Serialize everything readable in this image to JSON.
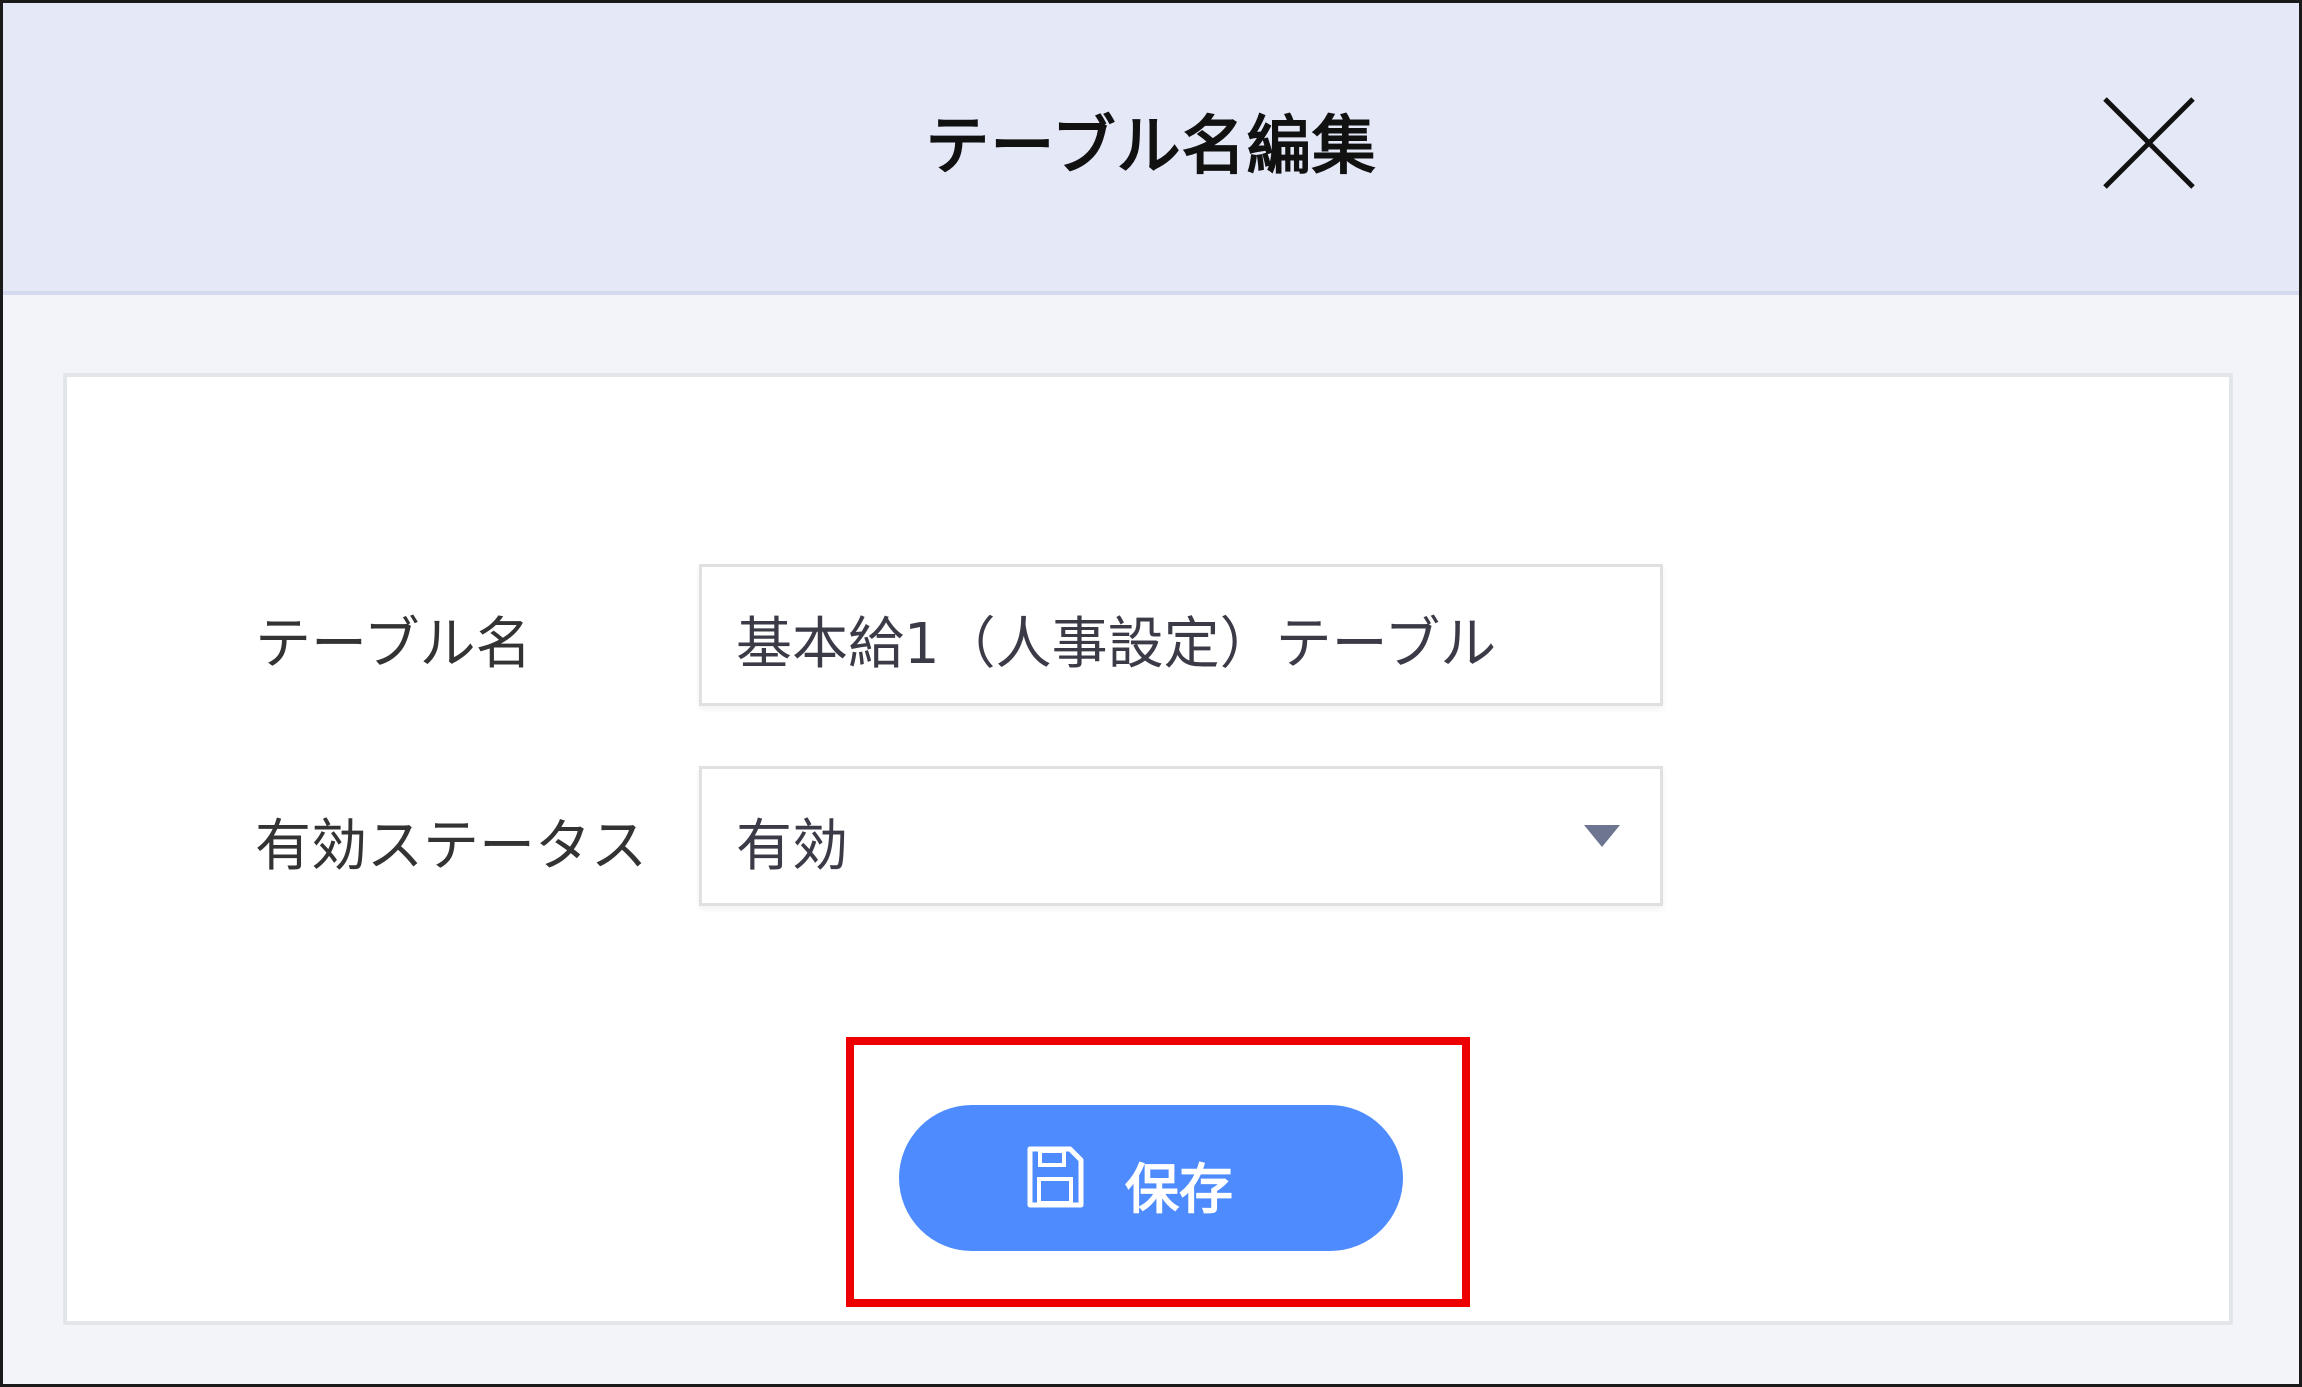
{
  "dialog": {
    "title": "テーブル名編集",
    "close_icon": "close-icon"
  },
  "form": {
    "table_name": {
      "label": "テーブル名",
      "value": "基本給1（人事設定）テーブル"
    },
    "status": {
      "label": "有効ステータス",
      "selected": "有効",
      "dropdown_icon": "dropdown-triangle-icon"
    }
  },
  "actions": {
    "save_label": "保存",
    "save_icon": "save-floppy-icon"
  },
  "colors": {
    "header_bg": "#e4e8f7",
    "body_bg": "#f3f4f9",
    "primary": "#4d8bff",
    "highlight": "#ee0000"
  }
}
